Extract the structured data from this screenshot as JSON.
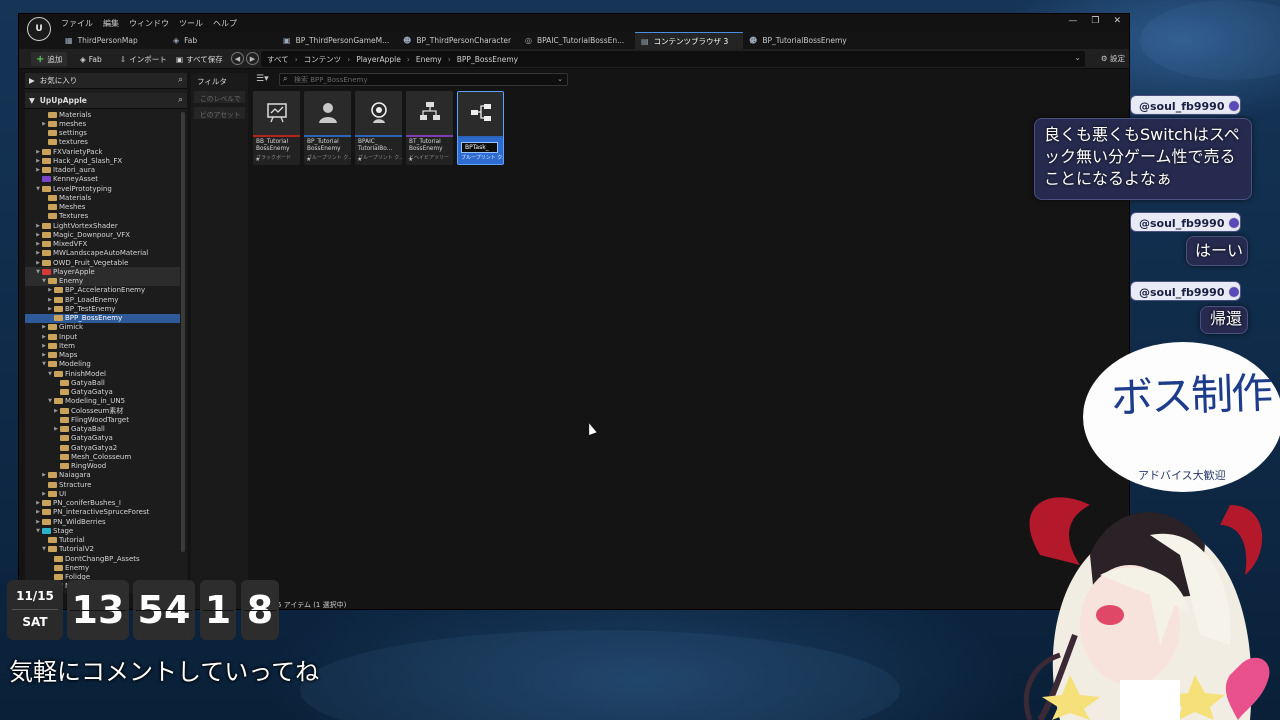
{
  "menu": [
    "ファイル",
    "編集",
    "ウィンドウ",
    "ツール",
    "ヘルプ"
  ],
  "tabs": [
    {
      "label": "ThirdPersonMap",
      "icon": "map-icon",
      "active": false
    },
    {
      "label": "Fab",
      "icon": "fab-icon",
      "active": false
    },
    {
      "label": "BP_ThirdPersonGameM...",
      "icon": "blueprint-icon",
      "active": false
    },
    {
      "label": "BP_ThirdPersonCharacter",
      "icon": "character-icon",
      "active": false
    },
    {
      "label": "BPAIC_TutorialBossEn...",
      "icon": "aicontroller-icon",
      "active": false
    },
    {
      "label": "コンテンツブラウザ 3",
      "icon": "folder-icon",
      "active": true
    },
    {
      "label": "BP_TutorialBossEnemy",
      "icon": "character-icon",
      "active": false
    }
  ],
  "toolbar": {
    "add": "追加",
    "fab": "Fab",
    "import": "インポート",
    "save_all": "すべて保存",
    "settings": "設定"
  },
  "breadcrumb": [
    "すべて",
    "コンテンツ",
    "PlayerApple",
    "Enemy",
    "BPP_BossEnemy"
  ],
  "sidebar": {
    "favorites": "お気に入り",
    "root": "UpUpApple"
  },
  "tree": [
    {
      "label": "Materials",
      "depth": 2,
      "arrow": "",
      "cls": ""
    },
    {
      "label": "meshes",
      "depth": 2,
      "arrow": "▶",
      "cls": ""
    },
    {
      "label": "settings",
      "depth": 2,
      "arrow": "",
      "cls": ""
    },
    {
      "label": "textures",
      "depth": 2,
      "arrow": "",
      "cls": ""
    },
    {
      "label": "FXVarietyPack",
      "depth": 1,
      "arrow": "▶",
      "cls": ""
    },
    {
      "label": "Hack_And_Slash_FX",
      "depth": 1,
      "arrow": "▶",
      "cls": ""
    },
    {
      "label": "Itadori_aura",
      "depth": 1,
      "arrow": "▶",
      "cls": ""
    },
    {
      "label": "KenneyAsset",
      "depth": 1,
      "arrow": "",
      "cls": "purple"
    },
    {
      "label": "LevelPrototyping",
      "depth": 1,
      "arrow": "▼",
      "cls": ""
    },
    {
      "label": "Materials",
      "depth": 2,
      "arrow": "",
      "cls": ""
    },
    {
      "label": "Meshes",
      "depth": 2,
      "arrow": "",
      "cls": ""
    },
    {
      "label": "Textures",
      "depth": 2,
      "arrow": "",
      "cls": ""
    },
    {
      "label": "LightVortexShader",
      "depth": 1,
      "arrow": "▶",
      "cls": ""
    },
    {
      "label": "Magic_Downpour_VFX",
      "depth": 1,
      "arrow": "▶",
      "cls": ""
    },
    {
      "label": "MixedVFX",
      "depth": 1,
      "arrow": "▶",
      "cls": ""
    },
    {
      "label": "MWLandscapeAutoMaterial",
      "depth": 1,
      "arrow": "▶",
      "cls": ""
    },
    {
      "label": "OWD_Fruit_Vegetable",
      "depth": 1,
      "arrow": "▶",
      "cls": ""
    },
    {
      "label": "PlayerApple",
      "depth": 1,
      "arrow": "▼",
      "cls": "red",
      "row": "hl"
    },
    {
      "label": "Enemy",
      "depth": 2,
      "arrow": "▼",
      "cls": "",
      "row": "hl"
    },
    {
      "label": "BP_AccelerationEnemy",
      "depth": 3,
      "arrow": "▶",
      "cls": ""
    },
    {
      "label": "BP_LoadEnemy",
      "depth": 3,
      "arrow": "▶",
      "cls": ""
    },
    {
      "label": "BP_TestEnemy",
      "depth": 3,
      "arrow": "▶",
      "cls": ""
    },
    {
      "label": "BPP_BossEnemy",
      "depth": 3,
      "arrow": "",
      "cls": "",
      "row": "sel"
    },
    {
      "label": "Gimick",
      "depth": 2,
      "arrow": "▶",
      "cls": ""
    },
    {
      "label": "Input",
      "depth": 2,
      "arrow": "▶",
      "cls": ""
    },
    {
      "label": "Item",
      "depth": 2,
      "arrow": "▶",
      "cls": ""
    },
    {
      "label": "Maps",
      "depth": 2,
      "arrow": "▶",
      "cls": ""
    },
    {
      "label": "Modeling",
      "depth": 2,
      "arrow": "▼",
      "cls": ""
    },
    {
      "label": "FinishModel",
      "depth": 3,
      "arrow": "▼",
      "cls": ""
    },
    {
      "label": "GatyaBall",
      "depth": 4,
      "arrow": "",
      "cls": ""
    },
    {
      "label": "GatyaGatya",
      "depth": 4,
      "arrow": "",
      "cls": ""
    },
    {
      "label": "Modeling_in_UN5",
      "depth": 3,
      "arrow": "▼",
      "cls": ""
    },
    {
      "label": "Colosseum素材",
      "depth": 4,
      "arrow": "▶",
      "cls": ""
    },
    {
      "label": "FlingWoodTarget",
      "depth": 4,
      "arrow": "",
      "cls": ""
    },
    {
      "label": "GatyaBall",
      "depth": 4,
      "arrow": "▶",
      "cls": ""
    },
    {
      "label": "GatyaGatya",
      "depth": 4,
      "arrow": "",
      "cls": ""
    },
    {
      "label": "GatyaGatya2",
      "depth": 4,
      "arrow": "",
      "cls": ""
    },
    {
      "label": "Mesh_Colosseum",
      "depth": 4,
      "arrow": "",
      "cls": ""
    },
    {
      "label": "RingWood",
      "depth": 4,
      "arrow": "",
      "cls": ""
    },
    {
      "label": "Naiagara",
      "depth": 2,
      "arrow": "▶",
      "cls": ""
    },
    {
      "label": "Stracture",
      "depth": 2,
      "arrow": "",
      "cls": ""
    },
    {
      "label": "UI",
      "depth": 2,
      "arrow": "▶",
      "cls": ""
    },
    {
      "label": "PN_coniferBushes_I",
      "depth": 1,
      "arrow": "▶",
      "cls": ""
    },
    {
      "label": "PN_interactiveSpruceForest",
      "depth": 1,
      "arrow": "▶",
      "cls": ""
    },
    {
      "label": "PN_WildBerries",
      "depth": 1,
      "arrow": "▶",
      "cls": ""
    },
    {
      "label": "Stage",
      "depth": 1,
      "arrow": "▼",
      "cls": "cyan"
    },
    {
      "label": "Tutorial",
      "depth": 2,
      "arrow": "",
      "cls": ""
    },
    {
      "label": "TutorialV2",
      "depth": 2,
      "arrow": "▼",
      "cls": ""
    },
    {
      "label": "DontChangBP_Assets",
      "depth": 3,
      "arrow": "",
      "cls": ""
    },
    {
      "label": "Enemy",
      "depth": 3,
      "arrow": "",
      "cls": ""
    },
    {
      "label": "Folidge",
      "depth": 3,
      "arrow": "",
      "cls": ""
    },
    {
      "label": "MapAssets",
      "depth": 3,
      "arrow": "▶",
      "cls": ""
    }
  ],
  "filters": {
    "title": "フィルタ",
    "items": [
      "このレベルで",
      "ビのアセット"
    ]
  },
  "search": {
    "placeholder": "検索 BPP_BossEnemy"
  },
  "assets": [
    {
      "name": "BB_Tutorial BossEnemy",
      "type": "ブラックボード",
      "icon": "blackboard-icon",
      "bar": "#b3261e",
      "selected": false
    },
    {
      "name": "BP_Tutorial BossEnemy",
      "type": "ブループリント ク...",
      "icon": "character-bust-icon",
      "bar": "#2a64b8",
      "selected": false
    },
    {
      "name": "BPAIC_ TutorialBo...",
      "type": "ブループリント ク...",
      "icon": "aicontroller-icon",
      "bar": "#2a64b8",
      "selected": false
    },
    {
      "name": "BT_Tutorial BossEnemy",
      "type": "ビヘイビアツリー",
      "icon": "behavior-tree-icon",
      "bar": "#7b3fb3",
      "selected": false
    },
    {
      "name": "BPTask_",
      "type": "ブループリント ク...",
      "icon": "bptask-icon",
      "bar": "#2a64b8",
      "selected": true
    }
  ],
  "status": "5 アイテム (1 選択中)",
  "clock": {
    "date": "11/15",
    "day": "SAT",
    "hh": "13",
    "mm": "54",
    "s1": "1",
    "s2": "8"
  },
  "caption": "気軽にコメントしていってね",
  "chat": [
    {
      "user": "@soul_fb9990",
      "text": "良くも悪くもSwitchはスペック無い分ゲーム性で売ることになるよなぁ"
    },
    {
      "user": "@soul_fb9990",
      "text": "はーい"
    },
    {
      "user": "@soul_fb9990",
      "text": "帰還"
    }
  ],
  "bubble": {
    "big": "ボス制作",
    "small": "アドバイス大歓迎"
  },
  "colors": {
    "accent": "#2d6bd1",
    "editor_bg": "#141414"
  }
}
